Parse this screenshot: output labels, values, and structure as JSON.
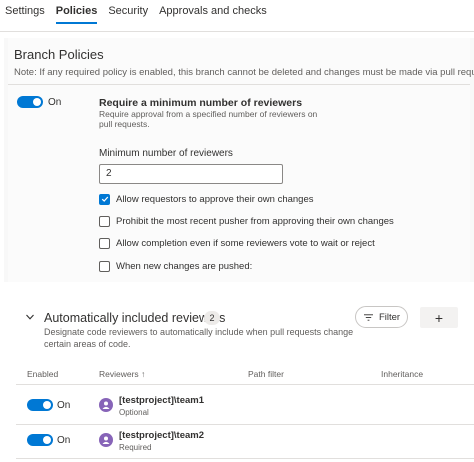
{
  "tabs": [
    {
      "label": "Settings",
      "active": false
    },
    {
      "label": "Policies",
      "active": true
    },
    {
      "label": "Security",
      "active": false
    },
    {
      "label": "Approvals and checks",
      "active": false
    }
  ],
  "branch_policies": {
    "title": "Branch Policies",
    "note": "Note: If any required policy is enabled, this branch cannot be deleted and changes must be made via pull request.",
    "min_reviewers": {
      "toggle_state": "On",
      "title": "Require a minimum number of reviewers",
      "description": "Require approval from a specified number of reviewers on pull requests.",
      "field_label": "Minimum number of reviewers",
      "field_value": "2",
      "options": [
        {
          "label": "Allow requestors to approve their own changes",
          "checked": true
        },
        {
          "label": "Prohibit the most recent pusher from approving their own changes",
          "checked": false
        },
        {
          "label": "Allow completion even if some reviewers vote to wait or reject",
          "checked": false
        },
        {
          "label": "When new changes are pushed:",
          "checked": false
        }
      ]
    }
  },
  "auto_reviewers": {
    "title": "Automatically included reviewers",
    "count": "2",
    "description": "Designate code reviewers to automatically include when pull requests change certain areas of code.",
    "filter_label": "Filter",
    "add_label": "+",
    "columns": {
      "enabled": "Enabled",
      "reviewers": "Reviewers ↑",
      "path_filter": "Path filter",
      "inheritance": "Inheritance"
    },
    "rows": [
      {
        "enabled": "On",
        "name": "[testproject]\\team1",
        "requirement": "Optional"
      },
      {
        "enabled": "On",
        "name": "[testproject]\\team2",
        "requirement": "Required"
      }
    ]
  },
  "colors": {
    "accent": "#0078d4",
    "avatar": "#8764b8"
  }
}
